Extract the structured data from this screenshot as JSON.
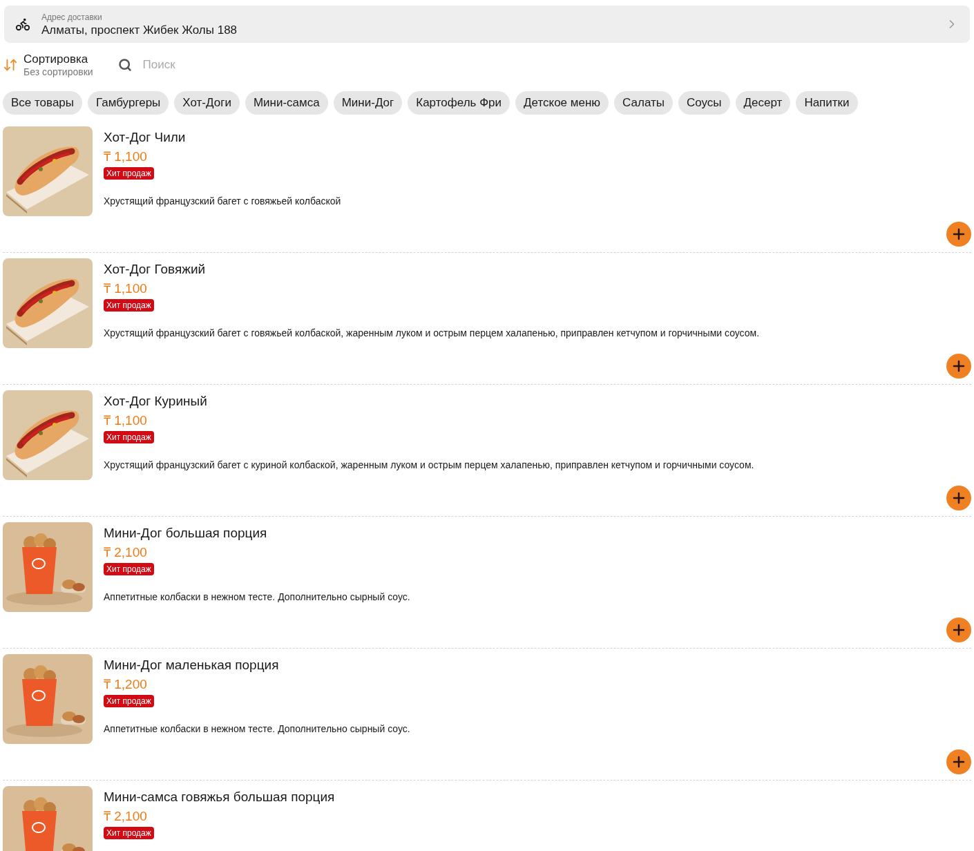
{
  "delivery": {
    "label": "Адрес доставки",
    "address": "Алматы, проспект Жибек Жолы 188"
  },
  "sort": {
    "title": "Сортировка",
    "value": "Без сортировки"
  },
  "search": {
    "placeholder": "Поиск"
  },
  "categories": [
    {
      "label": "Все товары",
      "selected": false
    },
    {
      "label": "Гамбургеры",
      "selected": false
    },
    {
      "label": "Хот-Доги",
      "selected": false
    },
    {
      "label": "Мини-самса",
      "selected": false
    },
    {
      "label": "Мини-Дог",
      "selected": false
    },
    {
      "label": "Картофель Фри",
      "selected": false
    },
    {
      "label": "Детское меню",
      "selected": false
    },
    {
      "label": "Салаты",
      "selected": false
    },
    {
      "label": "Соусы",
      "selected": false
    },
    {
      "label": "Десерт",
      "selected": false
    },
    {
      "label": "Напитки",
      "selected": false
    }
  ],
  "products": [
    {
      "kind": "hotdog",
      "name": "Хот-Дог Чили",
      "price": "₸ 1,100",
      "badge": "Хит продаж",
      "description": "Хрустящий французский багет с говяжьей колбаской"
    },
    {
      "kind": "hotdog",
      "name": "Хот-Дог Говяжий",
      "price": "₸ 1,100",
      "badge": "Хит продаж",
      "description": "Хрустящий французский багет с говяжьей колбаской, жаренным луком и острым перцем халапенью, приправлен кетчупом и горчичными соусом."
    },
    {
      "kind": "hotdog",
      "name": "Хот-Дог Куриный",
      "price": "₸ 1,100",
      "badge": "Хит продаж",
      "description": "Хрустящий французский багет с куриной колбаской, жаренным луком и острым перцем халапенью, приправлен кетчупом и горчичными соусом."
    },
    {
      "kind": "cup",
      "name": "Мини-Дог большая порция",
      "price": "₸ 2,100",
      "badge": "Хит продаж",
      "description": "Аппетитные колбаски в нежном тесте. Дополнительно сырный соус."
    },
    {
      "kind": "cup",
      "name": "Мини-Дог маленькая порция",
      "price": "₸ 1,200",
      "badge": "Хит продаж",
      "description": "Аппетитные колбаски в нежном тесте. Дополнительно сырный соус."
    },
    {
      "kind": "cup",
      "name": "Мини-самса говяжья большая порция",
      "price": "₸ 2,100",
      "badge": "Хит продаж"
    }
  ]
}
